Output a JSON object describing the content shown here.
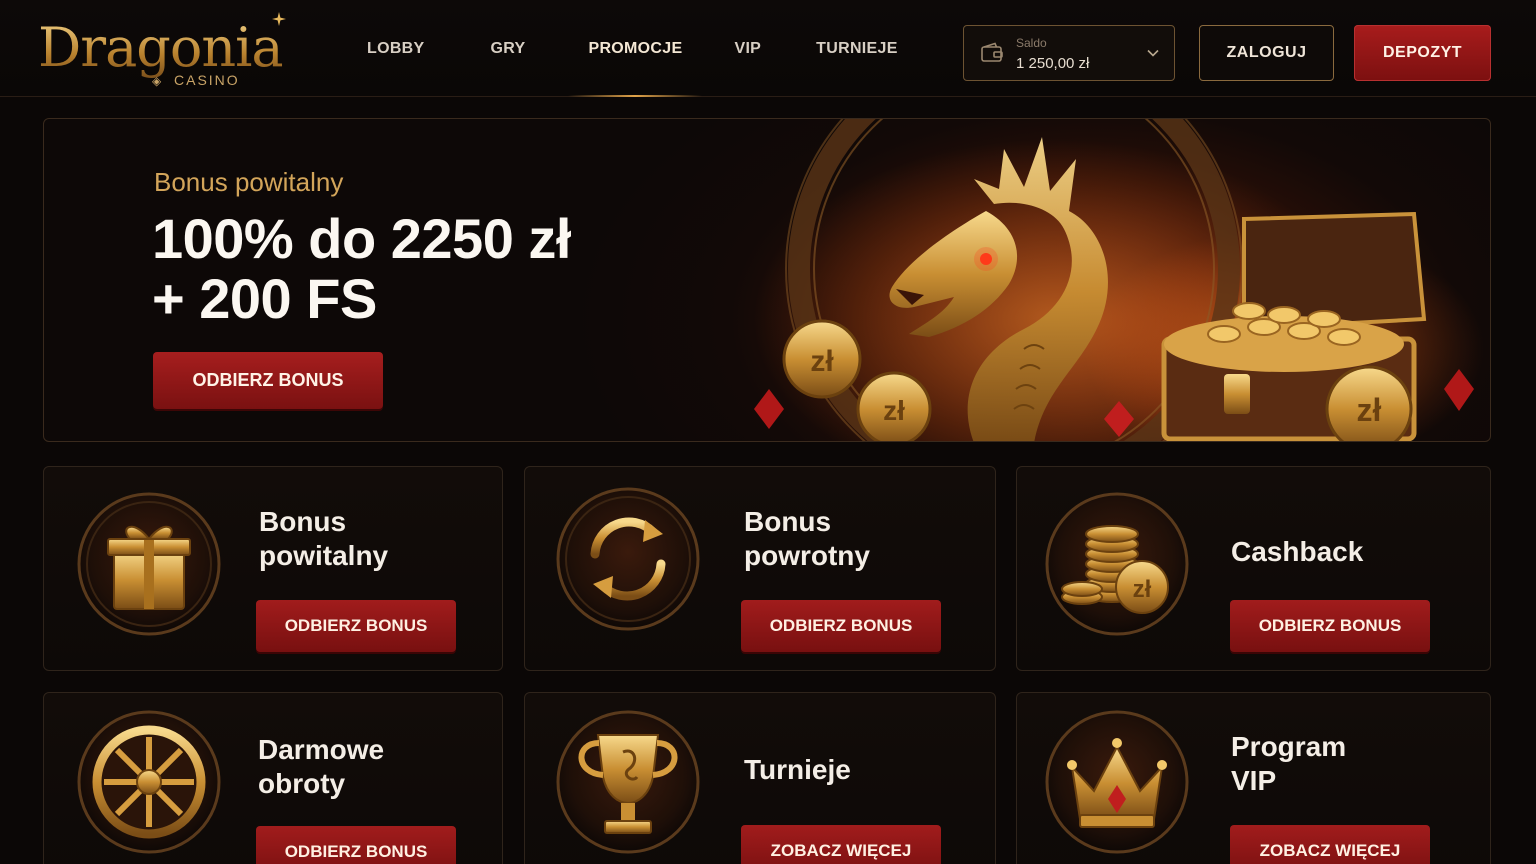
{
  "brand": {
    "name": "Dragonia",
    "sub": "CASINO"
  },
  "nav": [
    {
      "label": "LOBBY",
      "active": false
    },
    {
      "label": "GRY",
      "active": false
    },
    {
      "label": "PROMOCJE",
      "active": true
    },
    {
      "label": "VIP",
      "active": false
    },
    {
      "label": "TURNIEJE",
      "active": false
    }
  ],
  "balance": {
    "label": "Saldo",
    "value": "1 250,00 zł",
    "icon": "wallet-icon"
  },
  "header_buttons": {
    "login": "ZALOGUJ",
    "deposit": "DEPOZYT"
  },
  "hero": {
    "subtitle": "Bonus powitalny",
    "title_line1": "100% do 2250 zł",
    "title_line2": "+ 200 FS",
    "button": "ODBIERZ BONUS",
    "coin_label": "zł"
  },
  "cards": [
    {
      "title_line1": "Bonus",
      "title_line2": "powitalny",
      "button": "ODBIERZ BONUS",
      "icon": "gift-icon"
    },
    {
      "title_line1": "Bonus",
      "title_line2": "powrotny",
      "button": "ODBIERZ BONUS",
      "icon": "refresh-icon"
    },
    {
      "title_line1": "Cashback",
      "title_line2": "",
      "button": "ODBIERZ BONUS",
      "icon": "coins-icon"
    },
    {
      "title_line1": "Darmowe",
      "title_line2": "obroty",
      "button": "ODBIERZ BONUS",
      "icon": "wheel-icon"
    },
    {
      "title_line1": "Turnieje",
      "title_line2": "",
      "button": "ZOBACZ WIĘCEJ",
      "icon": "trophy-icon"
    },
    {
      "title_line1": "Program",
      "title_line2": "VIP",
      "button": "ZOBACZ WIĘCEJ",
      "icon": "crown-icon"
    }
  ],
  "colors": {
    "accent_red": "#a11c1c",
    "gold": "#d3a55a",
    "background": "#0b0706"
  }
}
